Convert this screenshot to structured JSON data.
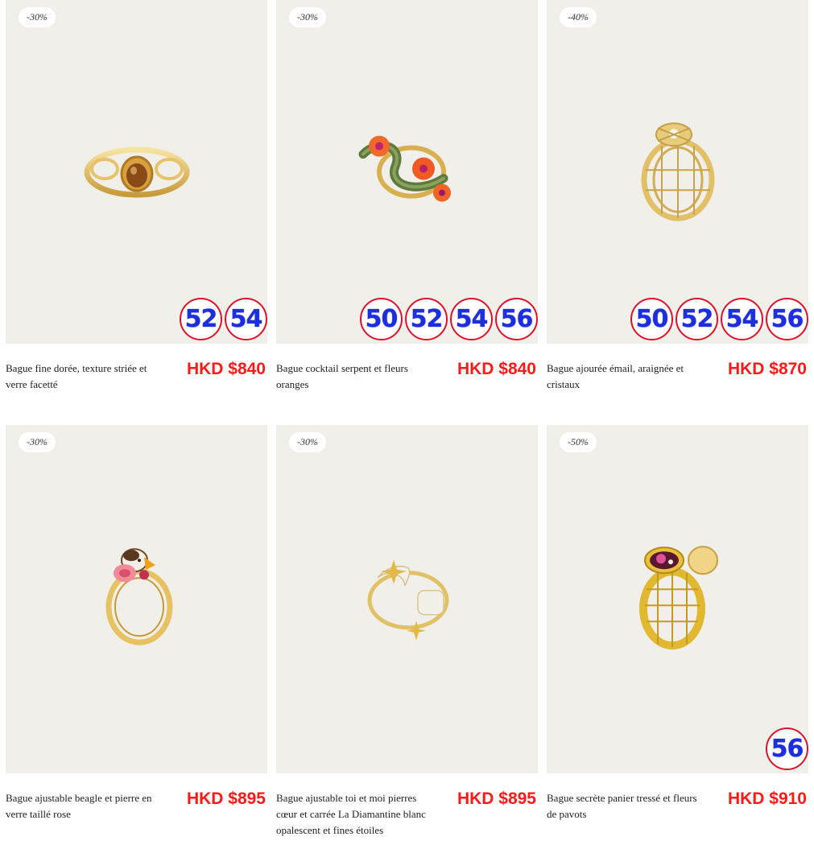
{
  "colors": {
    "card_bg": "#f0efea",
    "price": "#ff1a1a",
    "size_text": "#1c2ee0",
    "size_border": "#e0102a"
  },
  "products": [
    {
      "discount": "-30%",
      "name": "Bague fine dorée, texture striée et verre facetté",
      "price": "HKD $840",
      "sizes": [
        "52",
        "54"
      ],
      "icon": "gold-ring-amber-stone-icon"
    },
    {
      "discount": "-30%",
      "name": "Bague cocktail serpent et fleurs oranges",
      "price": "HKD $840",
      "sizes": [
        "50",
        "52",
        "54",
        "56"
      ],
      "icon": "snake-flower-ring-icon"
    },
    {
      "discount": "-40%",
      "name": "Bague ajourée émail, araignée et cristaux",
      "price": "HKD $870",
      "sizes": [
        "50",
        "52",
        "54",
        "56"
      ],
      "icon": "spider-web-ring-icon"
    },
    {
      "discount": "-30%",
      "name": "Bague ajustable beagle et pierre en verre taillé rose",
      "price": "HKD $895",
      "sizes": [],
      "icon": "beagle-ring-icon"
    },
    {
      "discount": "-30%",
      "name": "Bague ajustable toi et moi pierres cœur et carrée La Diamantine blanc opalescent et fines étoiles",
      "price": "HKD $895",
      "sizes": [],
      "icon": "toi-et-moi-ring-icon"
    },
    {
      "discount": "-50%",
      "name": "Bague secrète panier tressé et fleurs de pavots",
      "price": "HKD $910",
      "sizes": [
        "56"
      ],
      "icon": "basket-locket-ring-icon"
    }
  ]
}
